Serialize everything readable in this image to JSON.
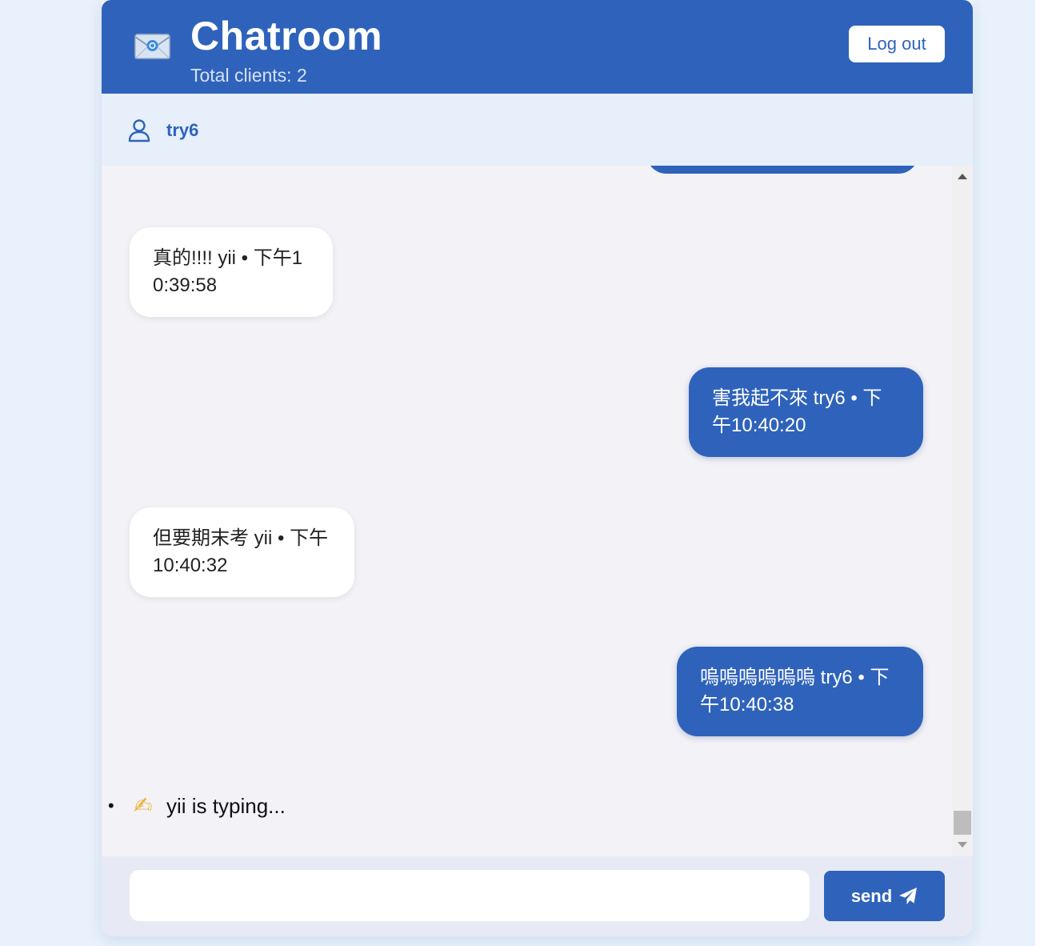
{
  "header": {
    "title": "Chatroom",
    "subtitle": "Total clients: 2",
    "logout_label": "Log out",
    "icon": "envelope-icon"
  },
  "user": {
    "name": "try6",
    "icon": "user-icon"
  },
  "messages": [
    {
      "direction": "incoming",
      "text": "真的!!!! yii • 下午10:39:58"
    },
    {
      "direction": "outgoing",
      "text": "害我起不來 try6 • 下午10:40:20"
    },
    {
      "direction": "incoming",
      "text": "但要期末考 yii • 下午10:40:32"
    },
    {
      "direction": "outgoing",
      "text": "嗚嗚嗚嗚嗚嗚 try6 • 下午10:40:38"
    }
  ],
  "typing": {
    "bullet": "•",
    "icon": "writing-hand-icon",
    "text": "yii is typing..."
  },
  "composer": {
    "input_value": "",
    "input_placeholder": "",
    "send_label": "send",
    "send_icon": "paper-plane-icon"
  },
  "colors": {
    "primary": "#2f63bb",
    "page_background": "#e8f1fc",
    "chat_background": "#f2f2f7",
    "user_bar": "#e6effa",
    "incoming_bubble": "#ffffff",
    "outgoing_bubble": "#2f63bb"
  }
}
